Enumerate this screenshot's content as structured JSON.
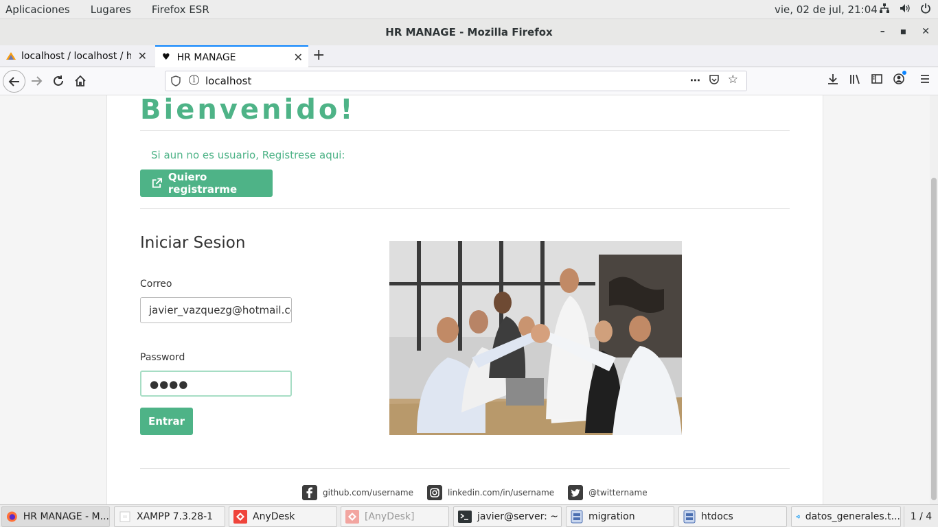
{
  "topbar": {
    "menus": [
      "Aplicaciones",
      "Lugares",
      "Firefox ESR"
    ],
    "clock": "vie, 02 de jul, 21:04",
    "icons": [
      "network-icon",
      "volume-icon",
      "power-icon"
    ]
  },
  "window": {
    "title": "HR MANAGE - Mozilla Firefox"
  },
  "tabs": [
    {
      "title": "localhost / localhost / hrm",
      "icon": "phpmyadmin-icon"
    },
    {
      "title": "HR MANAGE",
      "icon": "heart-icon"
    }
  ],
  "urlbar": {
    "url": "localhost"
  },
  "page": {
    "heading": "Bienvenido!",
    "register_prompt": "Si aun no es usuario, Registrese aqui:",
    "register_button": "Quiero registrarme",
    "login_title": "Iniciar Sesion",
    "email_label": "Correo",
    "email_value": "javier_vazquezg@hotmail.com",
    "password_label": "Password",
    "password_value": "●●●●",
    "submit_button": "Entrar",
    "footer": {
      "github": "github.com/username",
      "linkedin": "linkedin.com/in/username",
      "twitter": "@twittername"
    },
    "accent_color": "#4eb387"
  },
  "taskbar": {
    "items": [
      "HR MANAGE - M...",
      "XAMPP 7.3.28-1",
      "AnyDesk",
      "[AnyDesk]",
      "javier@server: ~",
      "migration",
      "htdocs",
      "datos_generales.t..."
    ],
    "pager": "1 / 4"
  }
}
